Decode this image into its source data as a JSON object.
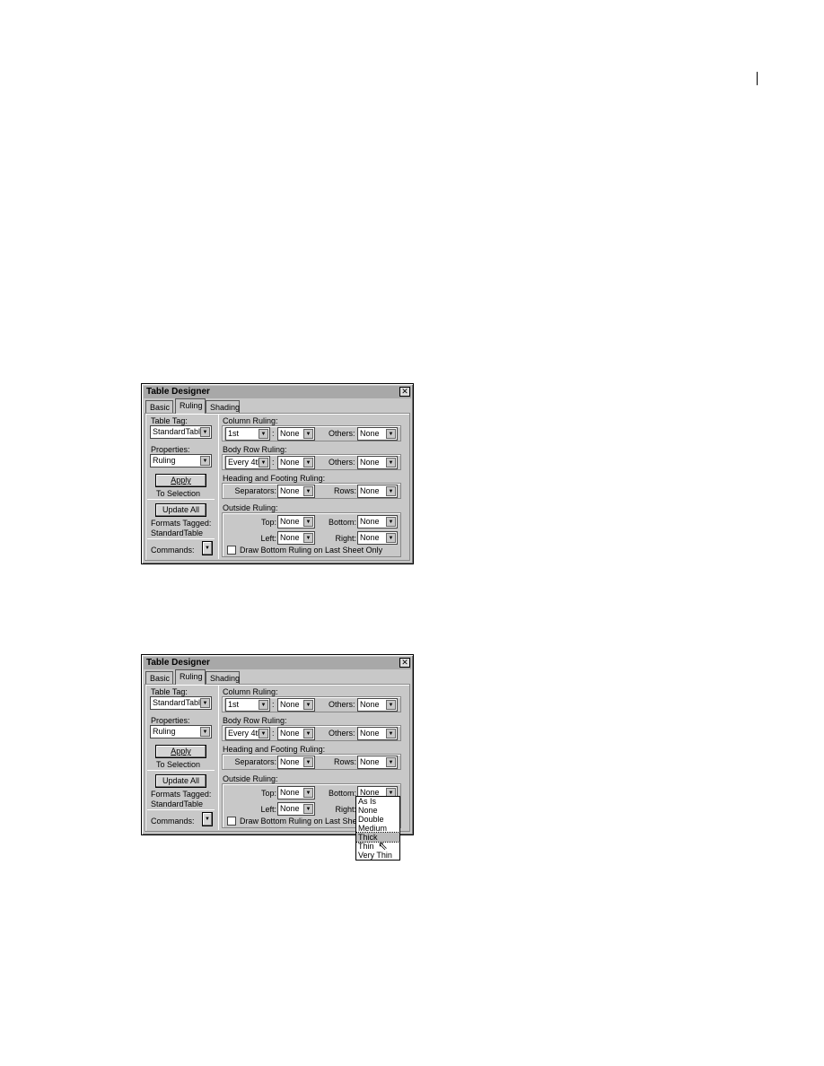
{
  "dialogs": [
    {
      "title": "Table Designer",
      "close": "✕",
      "tabs": [
        "Basic",
        "Ruling",
        "Shading"
      ],
      "active_tab": 1,
      "left": {
        "table_tag_label": "Table Tag:",
        "table_tag_value": "StandardTabl",
        "properties_label": "Properties:",
        "properties_value": "Ruling",
        "apply_label": "Apply",
        "to_selection": "To Selection",
        "update_all_label": "Update All",
        "formats_tagged": "Formats Tagged:",
        "formats_tag_name": "StandardTable",
        "commands_label": "Commands:"
      },
      "column_ruling": {
        "label": "Column Ruling:",
        "first": "1st",
        "colon": ":",
        "first_value": "None",
        "others_label": "Others:",
        "others_value": "None"
      },
      "body_row_ruling": {
        "label": "Body Row Ruling:",
        "first": "Every 4th",
        "colon": ":",
        "first_value": "None",
        "others_label": "Others:",
        "others_value": "None"
      },
      "heading_footing": {
        "label": "Heading and Footing Ruling:",
        "separators_label": "Separators:",
        "separators_value": "None",
        "rows_label": "Rows:",
        "rows_value": "None"
      },
      "outside": {
        "label": "Outside Ruling:",
        "top_label": "Top:",
        "top_value": "None",
        "bottom_label": "Bottom:",
        "bottom_value": "None",
        "left_label": "Left:",
        "left_value": "None",
        "right_label": "Right:",
        "right_value": "None",
        "checkbox_label": "Draw Bottom Ruling on Last Sheet Only",
        "checked": false
      }
    },
    {
      "title": "Table Designer",
      "close": "✕",
      "tabs": [
        "Basic",
        "Ruling",
        "Shading"
      ],
      "active_tab": 1,
      "left": {
        "table_tag_label": "Table Tag:",
        "table_tag_value": "StandardTabl",
        "properties_label": "Properties:",
        "properties_value": "Ruling",
        "apply_label": "Apply",
        "to_selection": "To Selection",
        "update_all_label": "Update All",
        "formats_tagged": "Formats Tagged:",
        "formats_tag_name": "StandardTable",
        "commands_label": "Commands:"
      },
      "column_ruling": {
        "label": "Column Ruling:",
        "first": "1st",
        "colon": ":",
        "first_value": "None",
        "others_label": "Others:",
        "others_value": "None"
      },
      "body_row_ruling": {
        "label": "Body Row Ruling:",
        "first": "Every 4th",
        "colon": ":",
        "first_value": "None",
        "others_label": "Others:",
        "others_value": "None"
      },
      "heading_footing": {
        "label": "Heading and Footing Ruling:",
        "separators_label": "Separators:",
        "separators_value": "None",
        "rows_label": "Rows:",
        "rows_value": "None"
      },
      "outside": {
        "label": "Outside Ruling:",
        "top_label": "Top:",
        "top_value": "None",
        "bottom_label": "Bottom:",
        "bottom_value": "None",
        "left_label": "Left:",
        "left_value": "None",
        "right_label": "Right:",
        "right_value": "None",
        "checkbox_label": "Draw Bottom Ruling on Last Sheet Only",
        "checked": false
      }
    }
  ],
  "bottom_dropdown": {
    "options": [
      "As Is",
      "None",
      "Double",
      "Medium",
      "Thick",
      "Thin",
      "Very Thin"
    ],
    "highlighted": "Thick"
  }
}
